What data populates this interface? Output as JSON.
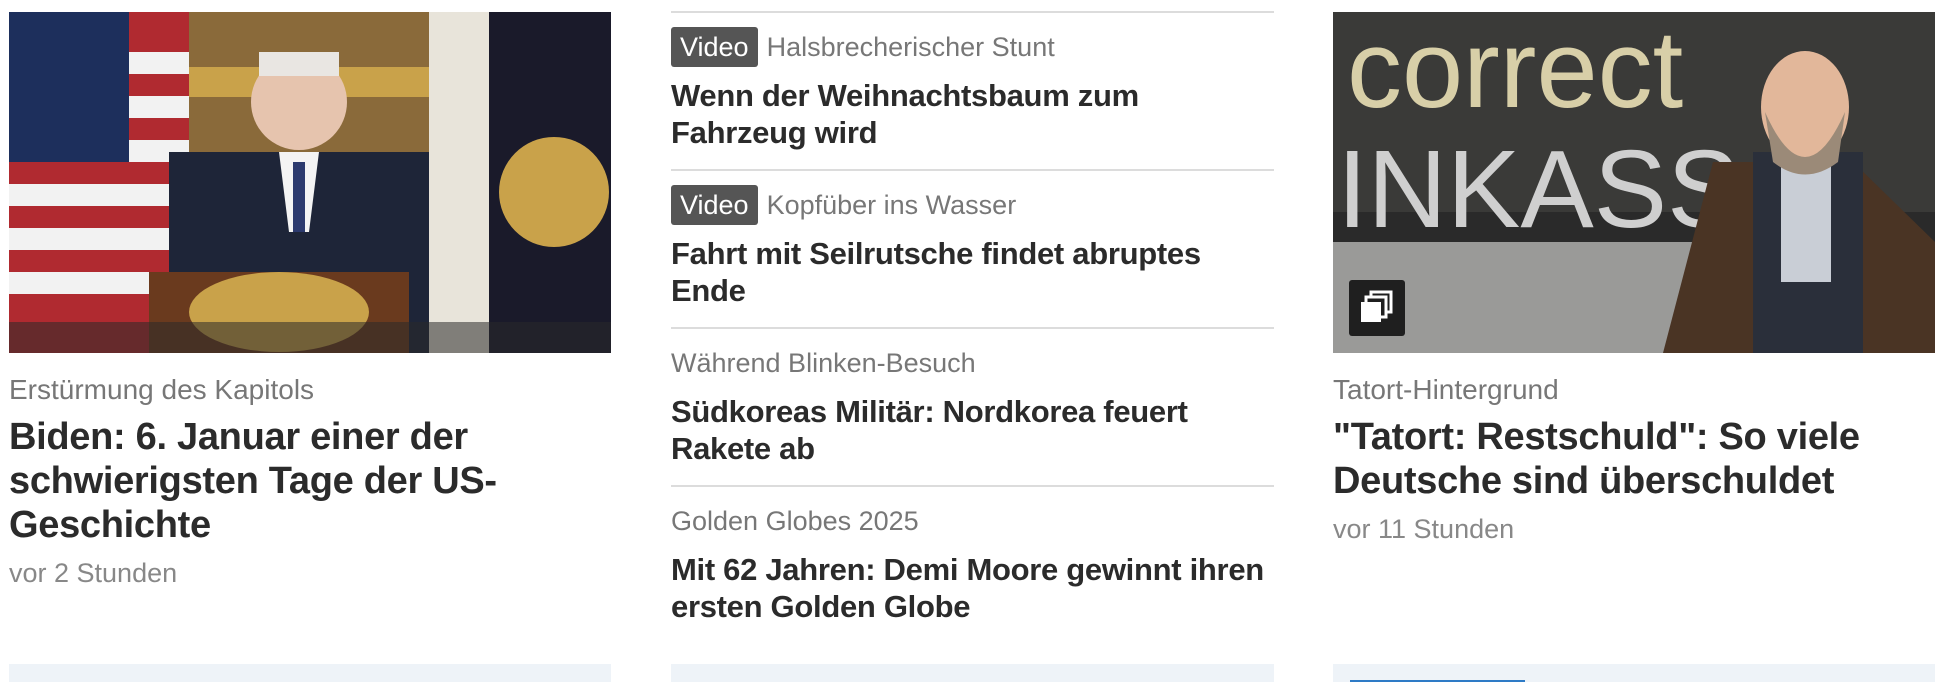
{
  "left": {
    "image_alt": "Biden am Rednerpult",
    "topline": "Erstürmung des Kapitols",
    "headline": "Biden: 6. Januar einer der schwierigsten Tage der US-Geschichte",
    "time": "vor 2 Stunden"
  },
  "middle": {
    "items": [
      {
        "label": "Video",
        "topline": "Halsbrecherischer Stunt",
        "headline": "Wenn der Weihnachtsbaum zum Fahrzeug wird"
      },
      {
        "label": "Video",
        "topline": "Kopfüber ins Wasser",
        "headline": "Fahrt mit Seilrutsche findet abruptes Ende"
      },
      {
        "label": "",
        "topline": "Während Blinken-Besuch",
        "headline": "Südkoreas Militär: Nordkorea feuert Rakete ab"
      },
      {
        "label": "",
        "topline": "Golden Globes 2025",
        "headline": "Mit 62 Jahren: Demi Moore gewinnt ihren ersten Golden Globe"
      }
    ]
  },
  "right": {
    "image_text_line1": "correct",
    "image_text_line2": "INKASS",
    "badge_icon": "gallery-icon",
    "topline": "Tatort-Hintergrund",
    "headline": "\"Tatort: Restschuld\": So viele Deutsche sind überschuldet",
    "time": "vor 11 Stunden"
  },
  "colors": {
    "video_label_bg": "#555555",
    "topline": "#777777",
    "headline": "#2b2b2b",
    "accent": "#2e7bc6"
  }
}
